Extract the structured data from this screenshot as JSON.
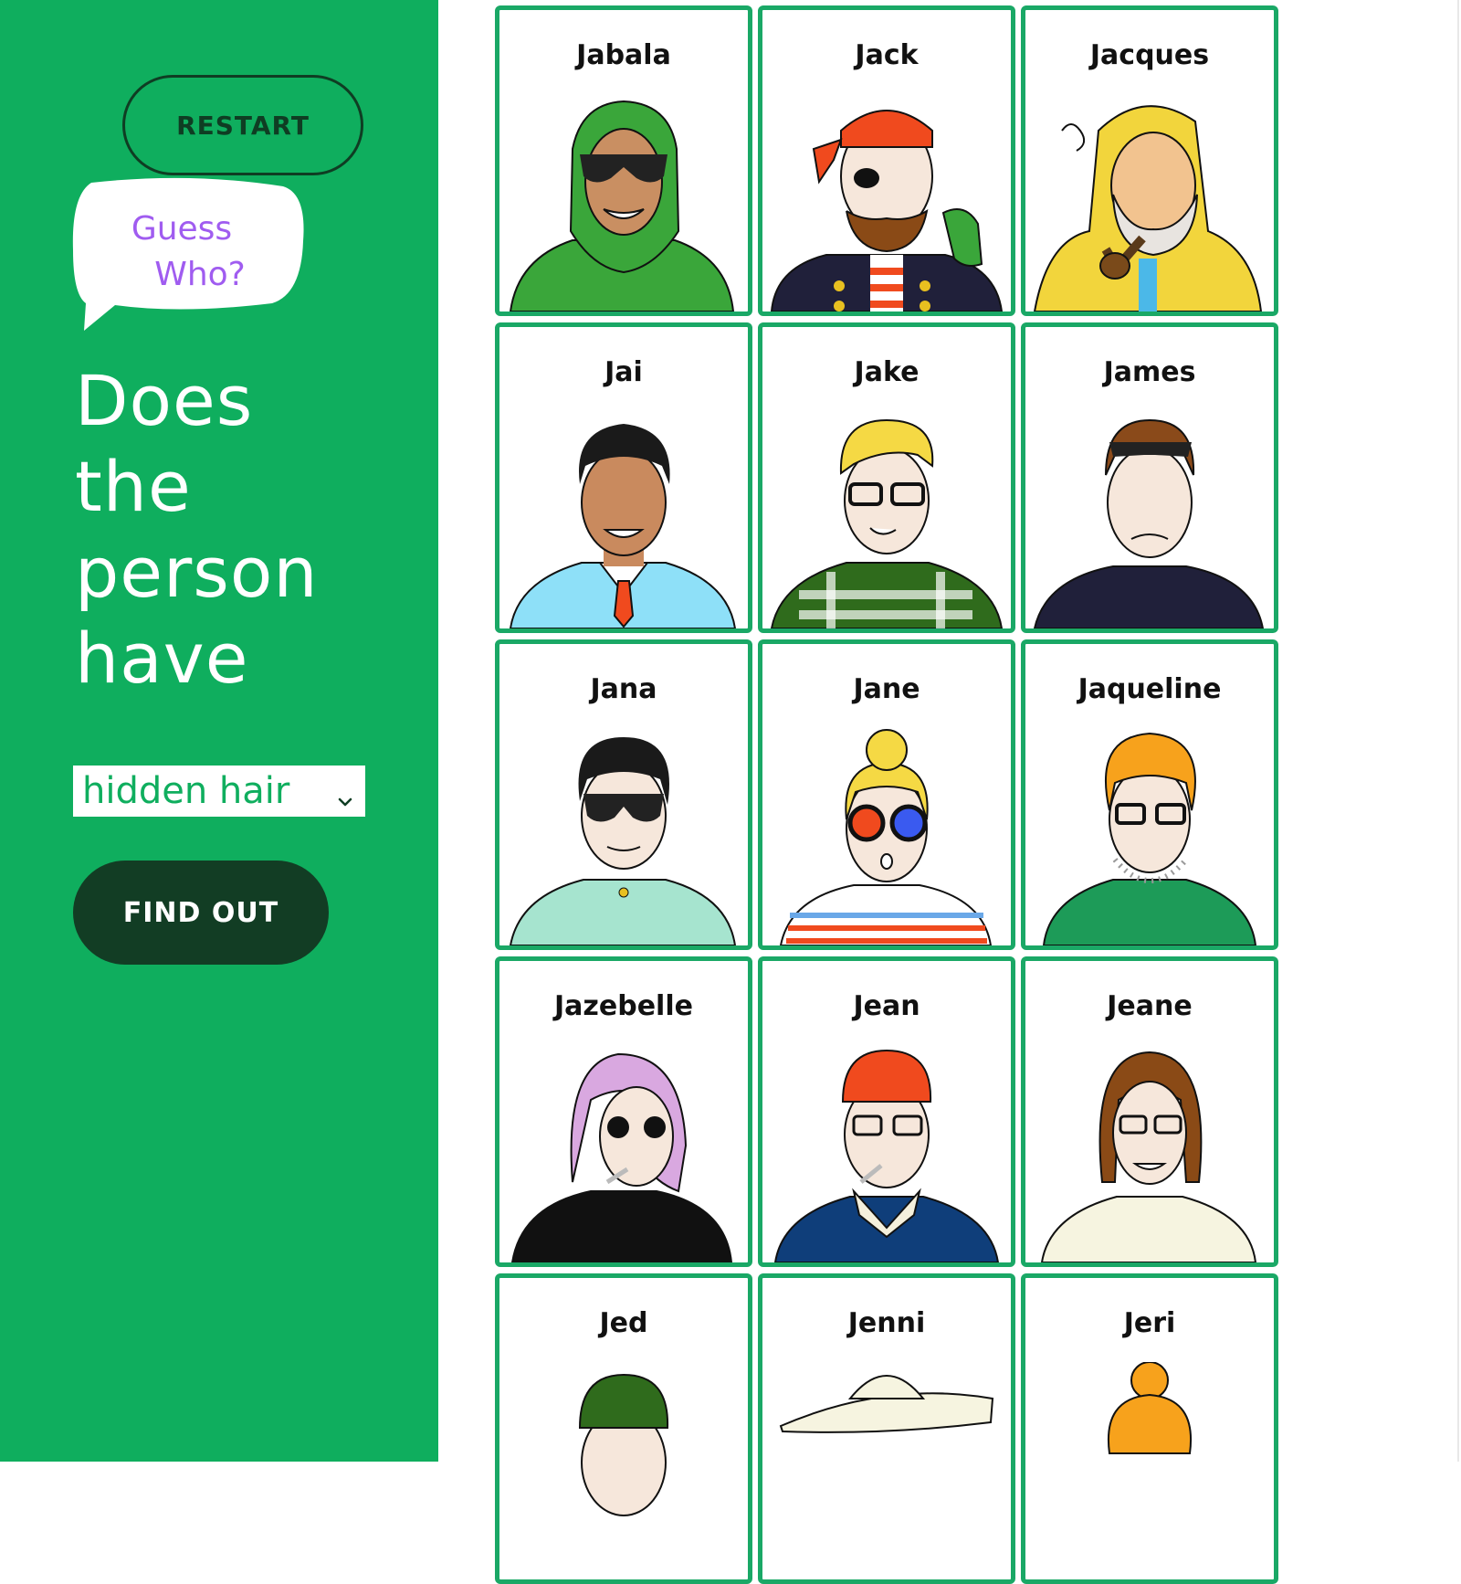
{
  "sidebar": {
    "restart_label": "RESTART",
    "logo": {
      "line1": "Guess",
      "line2": "Who?"
    },
    "question": {
      "line1": "Does",
      "line2": "the",
      "line3": "person",
      "line4": "have"
    },
    "select": {
      "value": "hidden hair",
      "icon": "chevron-down-icon"
    },
    "find_out_label": "FIND OUT"
  },
  "colors": {
    "sidebar_bg": "#0fae5e",
    "dark_green": "#123d24",
    "card_border": "#1aa866",
    "logo_text": "#a05cf0"
  },
  "cards": [
    {
      "name": "Jabala"
    },
    {
      "name": "Jack"
    },
    {
      "name": "Jacques"
    },
    {
      "name": "Jai"
    },
    {
      "name": "Jake"
    },
    {
      "name": "James"
    },
    {
      "name": "Jana"
    },
    {
      "name": "Jane"
    },
    {
      "name": "Jaqueline"
    },
    {
      "name": "Jazebelle"
    },
    {
      "name": "Jean"
    },
    {
      "name": "Jeane"
    },
    {
      "name": "Jed"
    },
    {
      "name": "Jenni"
    },
    {
      "name": "Jeri"
    }
  ]
}
